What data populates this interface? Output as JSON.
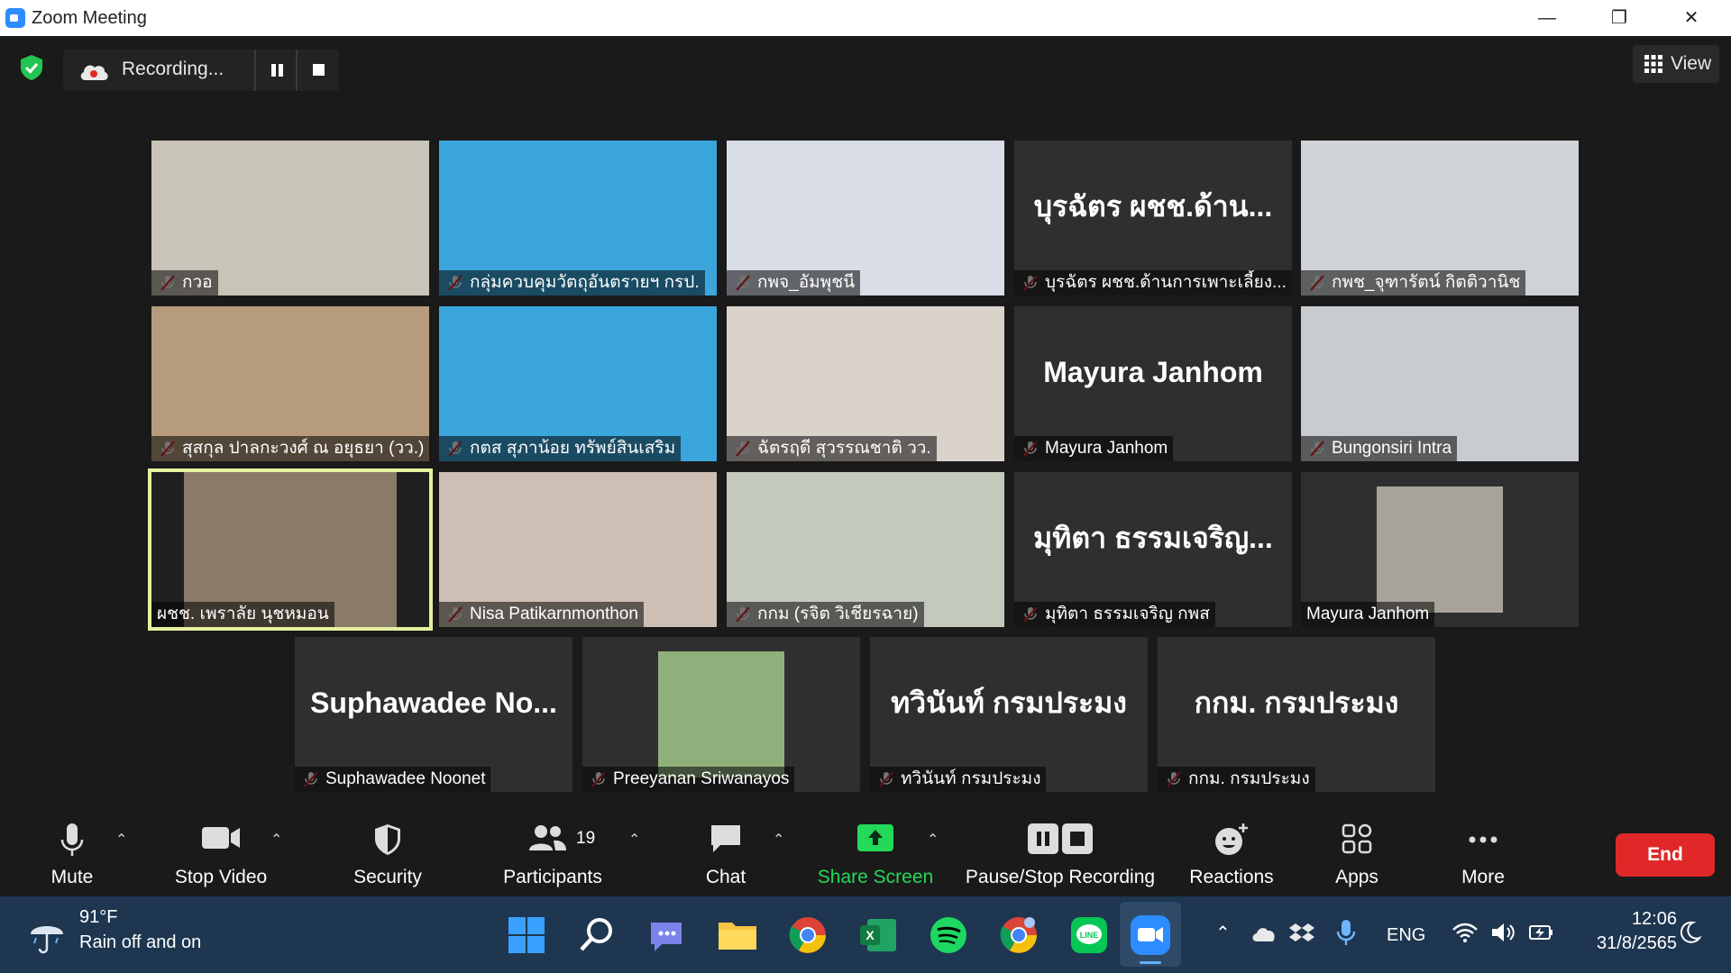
{
  "window": {
    "title": "Zoom Meeting",
    "minimize": "—",
    "restore": "❐",
    "close": "✕"
  },
  "recording": {
    "label": "Recording..."
  },
  "view_button": {
    "label": "View"
  },
  "tiles": [
    {
      "name": "กวอ",
      "big": "",
      "video": true,
      "mic_muted": true
    },
    {
      "name": "กลุ่มควบคุมวัตถุอันตรายฯ กรป.",
      "big": "",
      "video": true,
      "mic_muted": true
    },
    {
      "name": "กพจ_อัมพุชนี",
      "big": "",
      "video": true,
      "mic_muted": true
    },
    {
      "name": "บุรฉัตร ผชช.ด้านการเพาะเลี้ยง...",
      "big": "บุรฉัตร ผชช.ด้าน...",
      "video": false,
      "mic_muted": true
    },
    {
      "name": "กพช_จุฑารัตน์ กิตติวานิช",
      "big": "",
      "video": true,
      "mic_muted": true
    },
    {
      "name": "สุสกุล ปาลกะวงศ์ ณ อยุธยา (วว.)",
      "big": "",
      "video": true,
      "mic_muted": true
    },
    {
      "name": "กตส สุภาน้อย ทรัพย์สินเสริม",
      "big": "",
      "video": true,
      "mic_muted": true
    },
    {
      "name": "ฉัตรฤดี สุวรรณชาติ วว.",
      "big": "",
      "video": true,
      "mic_muted": true
    },
    {
      "name": "Mayura Janhom",
      "big": "Mayura Janhom",
      "video": false,
      "mic_muted": true
    },
    {
      "name": "Bungonsiri Intra",
      "big": "",
      "video": true,
      "mic_muted": true
    },
    {
      "name": "ผชช. เพราลัย นุชหมอน",
      "big": "",
      "video": true,
      "mic_muted": false,
      "active_speaker": true
    },
    {
      "name": "Nisa Patikarnmonthon",
      "big": "",
      "video": true,
      "mic_muted": true
    },
    {
      "name": "กกม (รจิต วิเชียรฉาย)",
      "big": "",
      "video": true,
      "mic_muted": true
    },
    {
      "name": "มุทิตา ธรรมเจริญ กพส",
      "big": "มุทิตา ธรรมเจริญ...",
      "video": false,
      "mic_muted": true
    },
    {
      "name": "Mayura Janhom",
      "big": "",
      "video": true,
      "mic_muted": false
    },
    {
      "name": "Suphawadee Noonet",
      "big": "Suphawadee  No...",
      "video": false,
      "mic_muted": true
    },
    {
      "name": "Preeyanan Sriwanayos",
      "big": "",
      "video": true,
      "mic_muted": true
    },
    {
      "name": "ทวินันท์ กรมประมง",
      "big": "ทวินันท์ กรมประมง",
      "video": false,
      "mic_muted": true
    },
    {
      "name": "กกม. กรมประมง",
      "big": "กกม. กรมประมง",
      "video": false,
      "mic_muted": true
    }
  ],
  "toolbar": {
    "mute": "Mute",
    "stop_video": "Stop Video",
    "security": "Security",
    "participants": "Participants",
    "participants_count": "19",
    "chat": "Chat",
    "share_screen": "Share Screen",
    "pause_stop_recording": "Pause/Stop Recording",
    "reactions": "Reactions",
    "apps": "Apps",
    "more": "More",
    "end": "End"
  },
  "colors": {
    "share_green": "#23d959",
    "end_red": "#e02828",
    "active_speaker": "#e6f0a0"
  },
  "taskbar": {
    "weather_temp": "91°F",
    "weather_cond": "Rain off and on",
    "language": "ENG",
    "time": "12:06",
    "date": "31/8/2565",
    "apps": [
      "windows-icon",
      "search-icon",
      "teams-chat-icon",
      "file-explorer-icon",
      "chrome-icon",
      "excel-icon",
      "spotify-icon",
      "chrome-alt-icon",
      "line-icon",
      "zoom-icon"
    ]
  }
}
